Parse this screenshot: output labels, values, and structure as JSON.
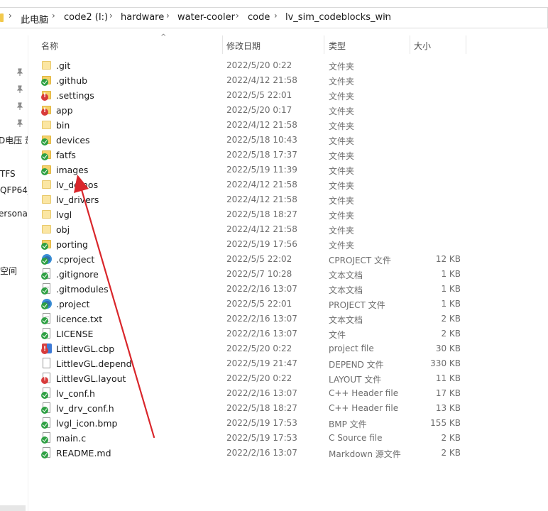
{
  "breadcrumb": {
    "items": [
      "此电脑",
      "code2 (I:)",
      "hardware",
      "water-cooler",
      "code",
      "lv_sim_codeblocks_win"
    ]
  },
  "nav": {
    "fragments": [
      "D电压 萧",
      "TFS",
      "QFP64_",
      "ersona",
      "空间"
    ]
  },
  "columns": {
    "name": "名称",
    "date": "修改日期",
    "type": "类型",
    "size": "大小"
  },
  "files": [
    {
      "name": ".git",
      "date": "2022/5/20 0:22",
      "type": "文件夹",
      "size": "",
      "icon": "folder-icon",
      "status": "none"
    },
    {
      "name": ".github",
      "date": "2022/4/12 21:58",
      "type": "文件夹",
      "size": "",
      "icon": "folder-icon",
      "status": "ok"
    },
    {
      "name": ".settings",
      "date": "2022/5/5 22:01",
      "type": "文件夹",
      "size": "",
      "icon": "folder-icon",
      "status": "err"
    },
    {
      "name": "app",
      "date": "2022/5/20 0:17",
      "type": "文件夹",
      "size": "",
      "icon": "folder-icon",
      "status": "err"
    },
    {
      "name": "bin",
      "date": "2022/4/12 21:58",
      "type": "文件夹",
      "size": "",
      "icon": "folder-icon",
      "status": "plain"
    },
    {
      "name": "devices",
      "date": "2022/5/18 10:43",
      "type": "文件夹",
      "size": "",
      "icon": "folder-icon",
      "status": "ok"
    },
    {
      "name": "fatfs",
      "date": "2022/5/18 17:37",
      "type": "文件夹",
      "size": "",
      "icon": "folder-icon",
      "status": "ok"
    },
    {
      "name": "images",
      "date": "2022/5/19 11:39",
      "type": "文件夹",
      "size": "",
      "icon": "folder-icon",
      "status": "ok"
    },
    {
      "name": "lv_demos",
      "date": "2022/4/12 21:58",
      "type": "文件夹",
      "size": "",
      "icon": "folder-icon",
      "status": "plain"
    },
    {
      "name": "lv_drivers",
      "date": "2022/4/12 21:58",
      "type": "文件夹",
      "size": "",
      "icon": "folder-icon",
      "status": "plain"
    },
    {
      "name": "lvgl",
      "date": "2022/5/18 18:27",
      "type": "文件夹",
      "size": "",
      "icon": "folder-icon",
      "status": "plain"
    },
    {
      "name": "obj",
      "date": "2022/4/12 21:58",
      "type": "文件夹",
      "size": "",
      "icon": "folder-icon",
      "status": "plain"
    },
    {
      "name": "porting",
      "date": "2022/5/19 17:56",
      "type": "文件夹",
      "size": "",
      "icon": "folder-icon",
      "status": "ok"
    },
    {
      "name": ".cproject",
      "date": "2022/5/5 22:02",
      "type": "CPROJECT 文件",
      "size": "12 KB",
      "icon": "eclipse-icon",
      "status": "ok"
    },
    {
      "name": ".gitignore",
      "date": "2022/5/7 10:28",
      "type": "文本文档",
      "size": "1 KB",
      "icon": "text-file-icon",
      "status": "ok"
    },
    {
      "name": ".gitmodules",
      "date": "2022/2/16 13:07",
      "type": "文本文档",
      "size": "1 KB",
      "icon": "text-file-icon",
      "status": "ok"
    },
    {
      "name": ".project",
      "date": "2022/5/5 22:01",
      "type": "PROJECT 文件",
      "size": "1 KB",
      "icon": "eclipse-icon",
      "status": "ok"
    },
    {
      "name": "licence.txt",
      "date": "2022/2/16 13:07",
      "type": "文本文档",
      "size": "2 KB",
      "icon": "text-file-icon",
      "status": "ok"
    },
    {
      "name": "LICENSE",
      "date": "2022/2/16 13:07",
      "type": "文件",
      "size": "2 KB",
      "icon": "file-icon",
      "status": "ok"
    },
    {
      "name": "LittlevGL.cbp",
      "date": "2022/5/20 0:22",
      "type": "project file",
      "size": "30 KB",
      "icon": "codeblocks-icon",
      "status": "err"
    },
    {
      "name": "LittlevGL.depend",
      "date": "2022/5/19 21:47",
      "type": "DEPEND 文件",
      "size": "330 KB",
      "icon": "file-icon",
      "status": "none"
    },
    {
      "name": "LittlevGL.layout",
      "date": "2022/5/20 0:22",
      "type": "LAYOUT 文件",
      "size": "11 KB",
      "icon": "file-icon",
      "status": "err"
    },
    {
      "name": "lv_conf.h",
      "date": "2022/2/16 13:07",
      "type": "C++ Header file",
      "size": "17 KB",
      "icon": "header-file-icon",
      "status": "ok"
    },
    {
      "name": "lv_drv_conf.h",
      "date": "2022/5/18 18:27",
      "type": "C++ Header file",
      "size": "13 KB",
      "icon": "header-file-icon",
      "status": "ok"
    },
    {
      "name": "lvgl_icon.bmp",
      "date": "2022/5/19 17:53",
      "type": "BMP 文件",
      "size": "155 KB",
      "icon": "image-file-icon",
      "status": "ok"
    },
    {
      "name": "main.c",
      "date": "2022/5/19 17:53",
      "type": "C Source file",
      "size": "2 KB",
      "icon": "source-file-icon",
      "status": "ok"
    },
    {
      "name": "README.md",
      "date": "2022/2/16 13:07",
      "type": "Markdown 源文件",
      "size": "2 KB",
      "icon": "file-icon",
      "status": "ok"
    }
  ],
  "annotation": {
    "arrow_color": "#d9262b"
  }
}
